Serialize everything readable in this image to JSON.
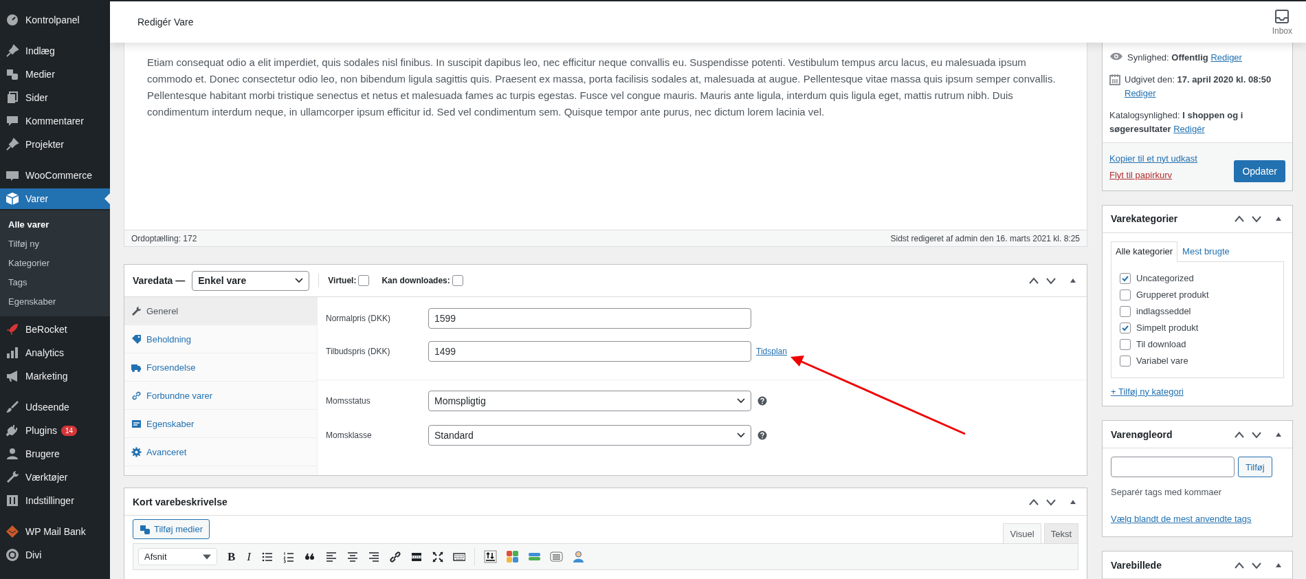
{
  "header": {
    "title": "Redigér Vare",
    "inbox_label": "Inbox"
  },
  "sidebar": {
    "groups": [
      [
        {
          "label": "Kontrolpanel",
          "selected": false
        }
      ],
      [
        {
          "label": "Indlæg",
          "selected": false
        },
        {
          "label": "Medier",
          "selected": false
        },
        {
          "label": "Sider",
          "selected": false
        },
        {
          "label": "Kommentarer",
          "selected": false
        },
        {
          "label": "Projekter",
          "selected": false
        }
      ],
      [
        {
          "label": "WooCommerce",
          "selected": false
        },
        {
          "label": "Varer",
          "selected": true,
          "children": [
            {
              "label": "Alle varer",
              "selected": true
            },
            {
              "label": "Tilføj ny",
              "selected": false
            },
            {
              "label": "Kategorier",
              "selected": false
            },
            {
              "label": "Tags",
              "selected": false
            },
            {
              "label": "Egenskaber",
              "selected": false
            }
          ]
        },
        {
          "label": "BeRocket",
          "selected": false
        },
        {
          "label": "Analytics",
          "selected": false
        },
        {
          "label": "Marketing",
          "selected": false
        }
      ],
      [
        {
          "label": "Udseende",
          "selected": false
        },
        {
          "label": "Plugins",
          "selected": false,
          "badge": "14"
        },
        {
          "label": "Brugere",
          "selected": false
        },
        {
          "label": "Værktøjer",
          "selected": false
        },
        {
          "label": "Indstillinger",
          "selected": false
        }
      ],
      [
        {
          "label": "WP Mail Bank",
          "selected": false
        },
        {
          "label": "Divi",
          "selected": false
        }
      ]
    ]
  },
  "editor": {
    "paragraph": "Etiam consequat odio a elit imperdiet, quis sodales nisl finibus. In suscipit dapibus leo, nec efficitur neque convallis eu. Suspendisse potenti. Vestibulum tempus arcu lacus, eu malesuada ipsum commodo et. Donec consectetur odio leo, non bibendum ligula sagittis quis. Praesent ex massa, porta facilisis sodales at, malesuada at augue. Pellentesque vitae massa quis ipsum semper convallis. Pellentesque habitant morbi tristique senectus et netus et malesuada fames ac turpis egestas. Fusce vel congue mauris. Mauris ante ligula, interdum quis ligula eget, mattis rutrum nibh. Duis condimentum interdum neque, in ullamcorper ipsum efficitur id. Sed vel condimentum sem. Quisque tempor ante purus, nec dictum lorem lacinia vel.",
    "word_count": "Ordoptælling: 172",
    "last_edited": "Sidst redigeret af admin den 16. marts 2021 kl. 8:25"
  },
  "product_data": {
    "title": "Varedata —",
    "type_select": "Enkel vare",
    "options": [
      {
        "label": "Virtuel:",
        "checked": false
      },
      {
        "label": "Kan downloades:",
        "checked": false
      }
    ],
    "tabs": [
      {
        "label": "Generel",
        "selected": true
      },
      {
        "label": "Beholdning",
        "selected": false
      },
      {
        "label": "Forsendelse",
        "selected": false
      },
      {
        "label": "Forbundne varer",
        "selected": false
      },
      {
        "label": "Egenskaber",
        "selected": false
      },
      {
        "label": "Avanceret",
        "selected": false
      }
    ],
    "field_groups": [
      [
        {
          "kind": "input",
          "label": "Normalpris (DKK)",
          "value": "1599"
        },
        {
          "kind": "input",
          "label": "Tilbudspris (DKK)",
          "value": "1499",
          "link": "Tidsplan"
        }
      ],
      [
        {
          "kind": "select",
          "label": "Momsstatus",
          "value": "Momspligtig",
          "help": true
        },
        {
          "kind": "select",
          "label": "Momsklasse",
          "value": "Standard",
          "help": true
        }
      ]
    ]
  },
  "short_description": {
    "title": "Kort varebeskrivelse",
    "add_media": "Tilføj medier",
    "editor_tabs": [
      {
        "label": "Visuel",
        "selected": true
      },
      {
        "label": "Tekst",
        "selected": false
      }
    ],
    "format_select": "Afsnit",
    "bold_glyph": "B",
    "italic_glyph": "I"
  },
  "publish": {
    "visibility": "Synlighed: **Offentlig**",
    "visibility_edit": "Rediger",
    "published": "Udgivet den: **17. april 2020 kl. 08:50**",
    "published_edit": "Rediger",
    "catalog": "Katalogsynlighed: **I shoppen og i søgeresultater**",
    "catalog_edit": "Redigér",
    "copy_link": "Kopier til et nyt udkast",
    "trash_link": "Flyt til papirkurv",
    "update_button": "Opdater"
  },
  "categories": {
    "title": "Varekategorier",
    "tabs": [
      {
        "label": "Alle kategorier",
        "selected": true
      },
      {
        "label": "Mest brugte",
        "selected": false
      }
    ],
    "items": [
      {
        "label": "Uncategorized",
        "checked": true
      },
      {
        "label": "Grupperet produkt",
        "checked": false
      },
      {
        "label": "indlagsseddel",
        "checked": false
      },
      {
        "label": "Simpelt produkt",
        "checked": true
      },
      {
        "label": "Til download",
        "checked": false
      },
      {
        "label": "Variabel vare",
        "checked": false
      }
    ],
    "add_link": "+ Tilføj ny kategori"
  },
  "tags": {
    "title": "Varenøgleord",
    "add_button": "Tilføj",
    "hint": "Separér tags med kommaer",
    "choose_link": "Vælg blandt de mest anvendte tags"
  },
  "image": {
    "title": "Varebillede"
  }
}
